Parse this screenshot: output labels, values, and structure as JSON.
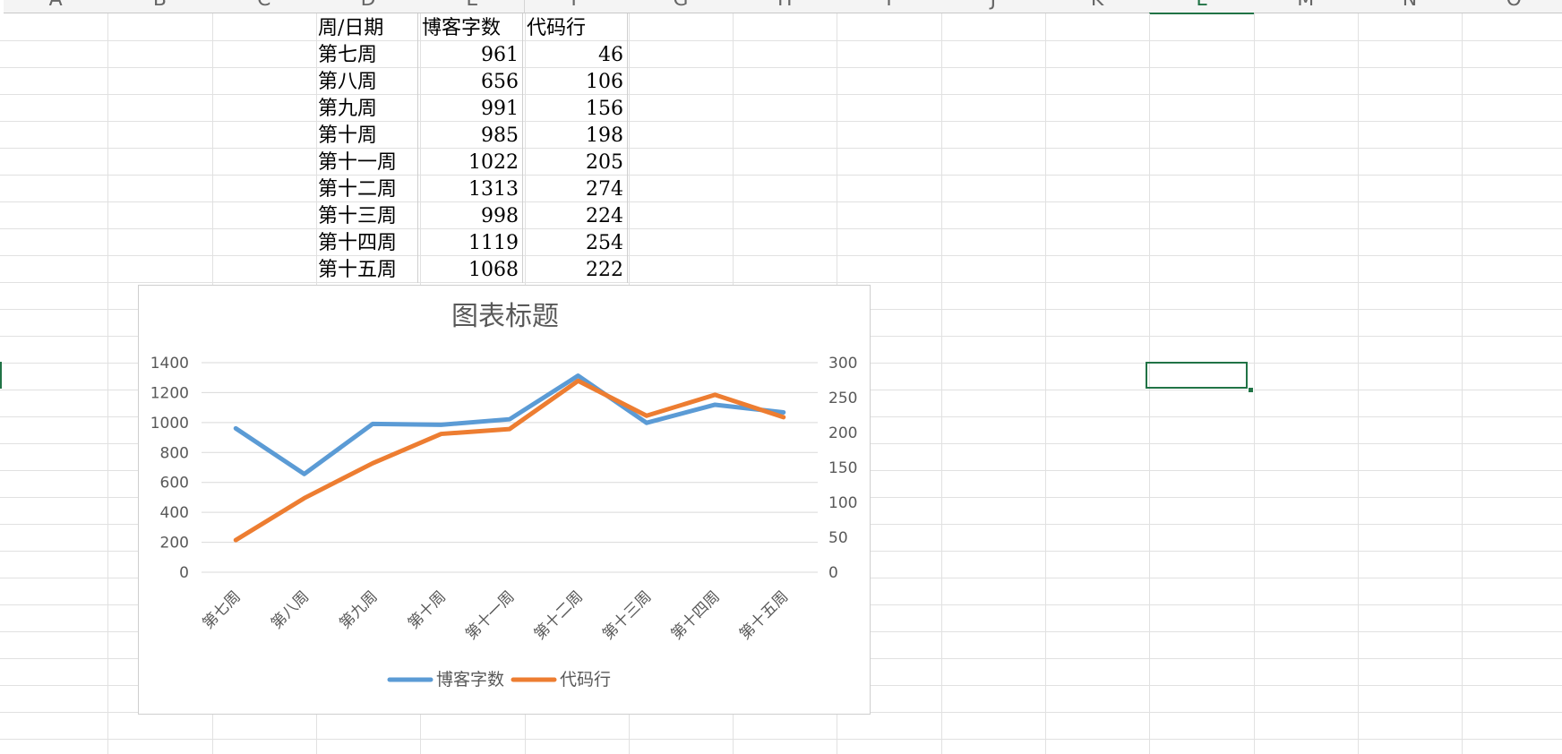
{
  "spreadsheet": {
    "columns": [
      "A",
      "B",
      "C",
      "D",
      "E",
      "F",
      "G",
      "H",
      "I",
      "J",
      "K",
      "L",
      "M",
      "N",
      "O"
    ],
    "active_column": "L",
    "table": {
      "headers": [
        "周/日期",
        "博客字数",
        "代码行"
      ],
      "rows": [
        [
          "第七周",
          "961",
          "46"
        ],
        [
          "第八周",
          "656",
          "106"
        ],
        [
          "第九周",
          "991",
          "156"
        ],
        [
          "第十周",
          "985",
          "198"
        ],
        [
          "第十一周",
          "1022",
          "205"
        ],
        [
          "第十二周",
          "1313",
          "274"
        ],
        [
          "第十三周",
          "998",
          "224"
        ],
        [
          "第十四周",
          "1119",
          "254"
        ],
        [
          "第十五周",
          "1068",
          "222"
        ]
      ]
    }
  },
  "chart_data": {
    "type": "line",
    "title": "图表标题",
    "categories": [
      "第七周",
      "第八周",
      "第九周",
      "第十周",
      "第十一周",
      "第十二周",
      "第十三周",
      "第十四周",
      "第十五周"
    ],
    "series": [
      {
        "name": "博客字数",
        "axis": "primary",
        "color": "#5b9bd5",
        "values": [
          961,
          656,
          991,
          985,
          1022,
          1313,
          998,
          1119,
          1068
        ]
      },
      {
        "name": "代码行",
        "axis": "secondary",
        "color": "#ed7d31",
        "values": [
          46,
          106,
          156,
          198,
          205,
          274,
          224,
          254,
          222
        ]
      }
    ],
    "y_primary": {
      "ylim": [
        0,
        1400
      ],
      "ticks": [
        "0",
        "200",
        "400",
        "600",
        "800",
        "1000",
        "1200",
        "1400"
      ]
    },
    "y_secondary": {
      "ylim": [
        0,
        300
      ],
      "ticks": [
        "0",
        "50",
        "100",
        "150",
        "200",
        "250",
        "300"
      ]
    },
    "grid": true,
    "legend_position": "bottom"
  }
}
